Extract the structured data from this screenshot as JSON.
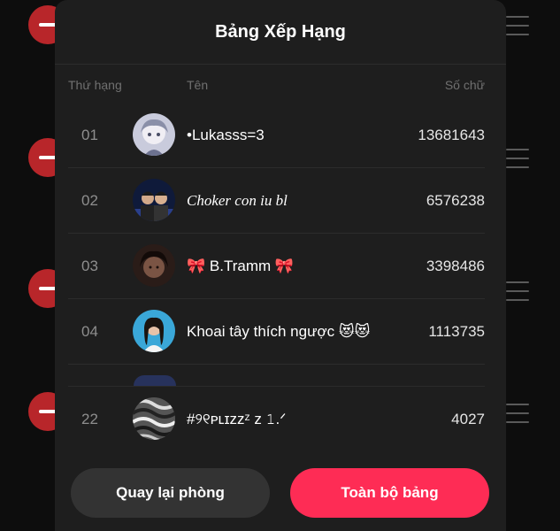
{
  "modal": {
    "title": "Bảng Xếp Hạng",
    "columns": {
      "rank": "Thứ hạng",
      "name": "Tên",
      "score": "Số chữ"
    }
  },
  "rows": [
    {
      "rank": "01",
      "name": "•Lukasss=3",
      "score": "13681643",
      "avatar_icon": "avatar-anime-boy"
    },
    {
      "rank": "02",
      "name": "Choker con iu bl",
      "score": "6576238",
      "avatar_icon": "avatar-two-people"
    },
    {
      "rank": "03",
      "name": "🎀 B.Tramm 🎀",
      "score": "3398486",
      "avatar_icon": "avatar-girl-dark"
    },
    {
      "rank": "04",
      "name": "Khoai tây thích ngược 😻😻",
      "score": "1113735",
      "avatar_icon": "avatar-girl-blue"
    }
  ],
  "my_rank": {
    "rank": "22",
    "name": "#୨୧ᴘʟɪᴢᴢᶻ z 𝟷.ᐟ",
    "score": "4027",
    "avatar_icon": "avatar-monochrome-pattern"
  },
  "buttons": {
    "back": "Quay lại phòng",
    "all": "Toàn bộ bảng"
  },
  "colors": {
    "accent": "#fe2c55",
    "remove": "#b8262a",
    "modal_bg": "#1e1e1e"
  }
}
